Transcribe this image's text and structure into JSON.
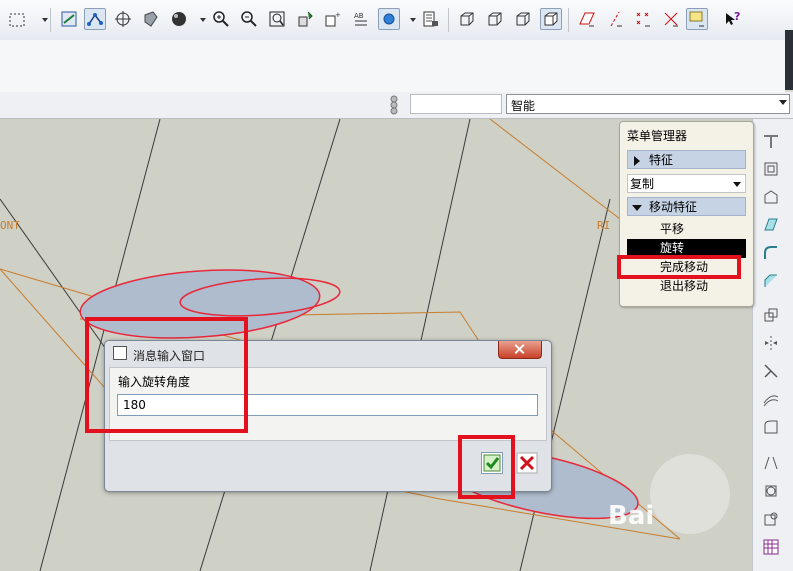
{
  "toolbar": {
    "icons": [
      "select-box-icon",
      "dropdown-icon",
      "datum-plane-icon",
      "datum-point-icon",
      "spin-center-icon",
      "shading-icon",
      "sphere-icon",
      "dropdown-icon",
      "zoom-in-icon",
      "zoom-out-icon",
      "refit-icon",
      "repaint-icon",
      "datum-axis-icon",
      "annotation-icon",
      "layers-icon",
      "named-view-icon",
      "dropdown-icon",
      "model-tree-icon",
      "wireframe-icon",
      "hidden-line-icon",
      "no-hidden-icon",
      "shading-icon",
      "sketch-edit-icon",
      "datum-axis-display-icon",
      "datum-point-display-icon",
      "coord-sys-icon",
      "annotation-display-icon",
      "whats-this-icon"
    ]
  },
  "filter_bar": {
    "selected": "智能"
  },
  "menu_manager": {
    "title": "菜单管理器",
    "feature_header": "特征",
    "copy_dropdown": "复制",
    "move_header": "移动特征",
    "items": [
      "平移",
      "旋转",
      "完成移动",
      "退出移动"
    ],
    "selected_item": "旋转",
    "highlighted_item": "完成移动"
  },
  "graphics": {
    "label_front": "ONT",
    "label_right": "RI",
    "watermark": "Bai"
  },
  "dialog": {
    "title": "消息输入窗口",
    "prompt": "输入旋转角度",
    "value": "180",
    "ok_icon": "check-icon",
    "cancel_icon": "cancel-icon"
  },
  "colors": {
    "highlight": "#e3111d",
    "sketch": "#e8283b",
    "datum": "#c87d2e",
    "selected": "#000000"
  }
}
